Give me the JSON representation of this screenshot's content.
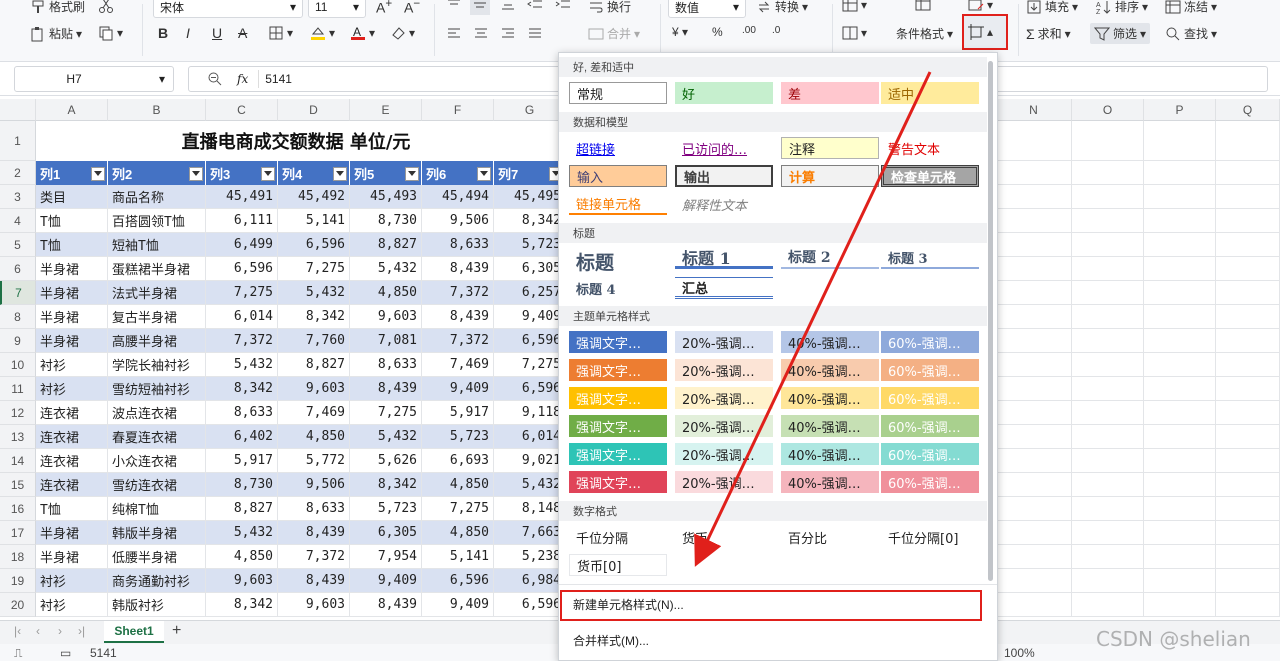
{
  "ribbon": {
    "format_painter": "格式刷",
    "paste": "粘贴",
    "font_name": "宋体",
    "font_size": "11",
    "wrap": "换行",
    "merge": "合并",
    "number_format": "数值",
    "convert": "转换",
    "conditional_format": "条件格式",
    "fill": "填充",
    "sort": "排序",
    "freeze": "冻结",
    "sum": "求和",
    "filter": "筛选",
    "find": "查找"
  },
  "formula_bar": {
    "name_box": "H7",
    "fx": "fx",
    "value": "5141"
  },
  "columns": [
    "A",
    "B",
    "C",
    "D",
    "E",
    "F",
    "G",
    "N",
    "O",
    "P",
    "Q"
  ],
  "sheet": {
    "title": "直播电商成交额数据 单位/元",
    "header": [
      "列1",
      "列2",
      "列3",
      "列4",
      "列5",
      "列6",
      "列7"
    ],
    "rows": [
      [
        "类目",
        "商品名称",
        "45,491",
        "45,492",
        "45,493",
        "45,494",
        "45,495"
      ],
      [
        "T恤",
        "百搭圆领T恤",
        "6,111",
        "5,141",
        "8,730",
        "9,506",
        "8,342"
      ],
      [
        "T恤",
        "短袖T恤",
        "6,499",
        "6,596",
        "8,827",
        "8,633",
        "5,723"
      ],
      [
        "半身裙",
        "蛋糕裙半身裙",
        "6,596",
        "7,275",
        "5,432",
        "8,439",
        "6,305"
      ],
      [
        "半身裙",
        "法式半身裙",
        "7,275",
        "5,432",
        "4,850",
        "7,372",
        "6,257"
      ],
      [
        "半身裙",
        "复古半身裙",
        "6,014",
        "8,342",
        "9,603",
        "8,439",
        "9,409"
      ],
      [
        "半身裙",
        "高腰半身裙",
        "7,372",
        "7,760",
        "7,081",
        "7,372",
        "6,596"
      ],
      [
        "衬衫",
        "学院长袖衬衫",
        "5,432",
        "8,827",
        "8,633",
        "7,469",
        "7,275"
      ],
      [
        "衬衫",
        "雪纺短袖衬衫",
        "8,342",
        "9,603",
        "8,439",
        "9,409",
        "6,596"
      ],
      [
        "连衣裙",
        "波点连衣裙",
        "8,633",
        "7,469",
        "7,275",
        "5,917",
        "9,118"
      ],
      [
        "连衣裙",
        "春夏连衣裙",
        "6,402",
        "4,850",
        "5,432",
        "5,723",
        "6,014"
      ],
      [
        "连衣裙",
        "小众连衣裙",
        "5,917",
        "5,772",
        "5,626",
        "6,693",
        "9,021"
      ],
      [
        "连衣裙",
        "雪纺连衣裙",
        "8,730",
        "9,506",
        "8,342",
        "4,850",
        "5,432"
      ],
      [
        "T恤",
        "纯棉T恤",
        "8,827",
        "8,633",
        "5,723",
        "7,275",
        "8,148"
      ],
      [
        "半身裙",
        "韩版半身裙",
        "5,432",
        "8,439",
        "6,305",
        "4,850",
        "7,663"
      ],
      [
        "半身裙",
        "低腰半身裙",
        "4,850",
        "7,372",
        "7,954",
        "5,141",
        "5,238"
      ],
      [
        "衬衫",
        "商务通勤衬衫",
        "9,603",
        "8,439",
        "9,409",
        "6,596",
        "6,984"
      ],
      [
        "衬衫",
        "韩版衬衫",
        "8,342",
        "9,603",
        "8,439",
        "9,409",
        "6,596"
      ]
    ],
    "row_numbers": [
      "1",
      "2",
      "3",
      "4",
      "5",
      "6",
      "7",
      "8",
      "9",
      "10",
      "11",
      "12",
      "13",
      "14",
      "15",
      "16",
      "17",
      "18",
      "19",
      "20"
    ]
  },
  "sheet_tab": "Sheet1",
  "status": {
    "value": "5141",
    "zoom": "100%"
  },
  "panel": {
    "sections": {
      "good_bad": "好, 差和适中",
      "data_model": "数据和模型",
      "titles": "标题",
      "theme": "主题单元格样式",
      "number": "数字格式"
    },
    "good_bad": [
      "常规",
      "好",
      "差",
      "适中"
    ],
    "data_model_row1": [
      "超链接",
      "已访问的…",
      "注释",
      "警告文本"
    ],
    "data_model_row2": [
      "输入",
      "输出",
      "计算",
      "检查单元格"
    ],
    "data_model_row3": [
      "链接单元格",
      "解释性文本"
    ],
    "titles_row1": [
      "标题",
      "标题 1",
      "标题 2",
      "标题 3"
    ],
    "titles_row2": [
      "标题 4",
      "汇总"
    ],
    "theme_labels": [
      "强调文字…",
      "20%-强调…",
      "40%-强调…",
      "60%-强调…"
    ],
    "number_row1": [
      "千位分隔",
      "货币",
      "百分比",
      "千位分隔[0]"
    ],
    "number_row2": [
      "货币[0]"
    ],
    "new_style": "新建单元格样式(N)...",
    "merge_style": "合并样式(M)..."
  },
  "colors": {
    "header_blue": "#4472c4",
    "band_blue": "#d9e1f2",
    "highlight_red": "#e0201b",
    "theme_accents": [
      "#4472c4",
      "#ed7d31",
      "#ffc000",
      "#70ad47",
      "#2ec4b6",
      "#e04459"
    ]
  },
  "watermark": "CSDN @shelian"
}
